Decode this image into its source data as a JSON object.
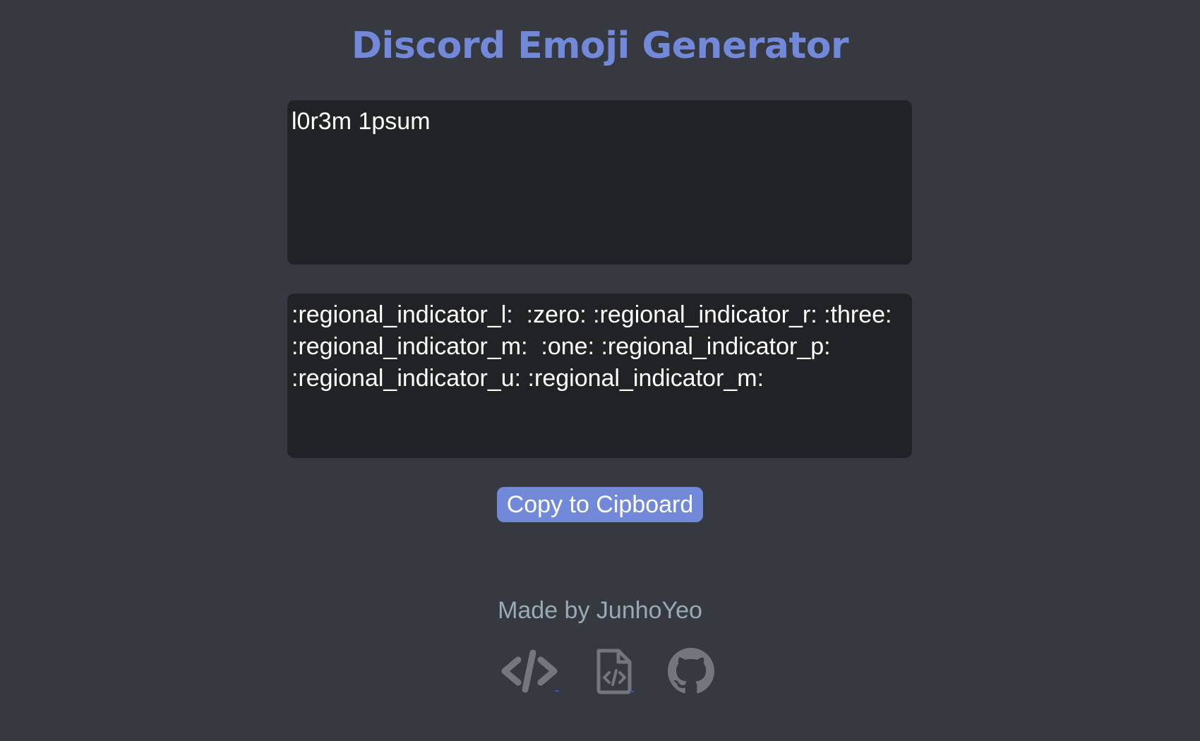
{
  "header": {
    "title": "Discord Emoji Generator"
  },
  "input": {
    "value": "l0r3m 1psum"
  },
  "output": {
    "value": ":regional_indicator_l:  :zero: :regional_indicator_r: :three: :regional_indicator_m:  :one: :regional_indicator_p: :regional_indicator_u: :regional_indicator_m:"
  },
  "actions": {
    "copy_label": "Copy to Cipboard"
  },
  "footer": {
    "credit": "Made by JunhoYeo",
    "links": [
      {
        "icon": "code-icon"
      },
      {
        "icon": "file-code-icon"
      },
      {
        "icon": "github-icon"
      }
    ]
  },
  "colors": {
    "background": "#36393f",
    "accent": "#7289da",
    "textbox": "#202225",
    "muted_text": "#99aab5",
    "icon": "#72767d"
  }
}
